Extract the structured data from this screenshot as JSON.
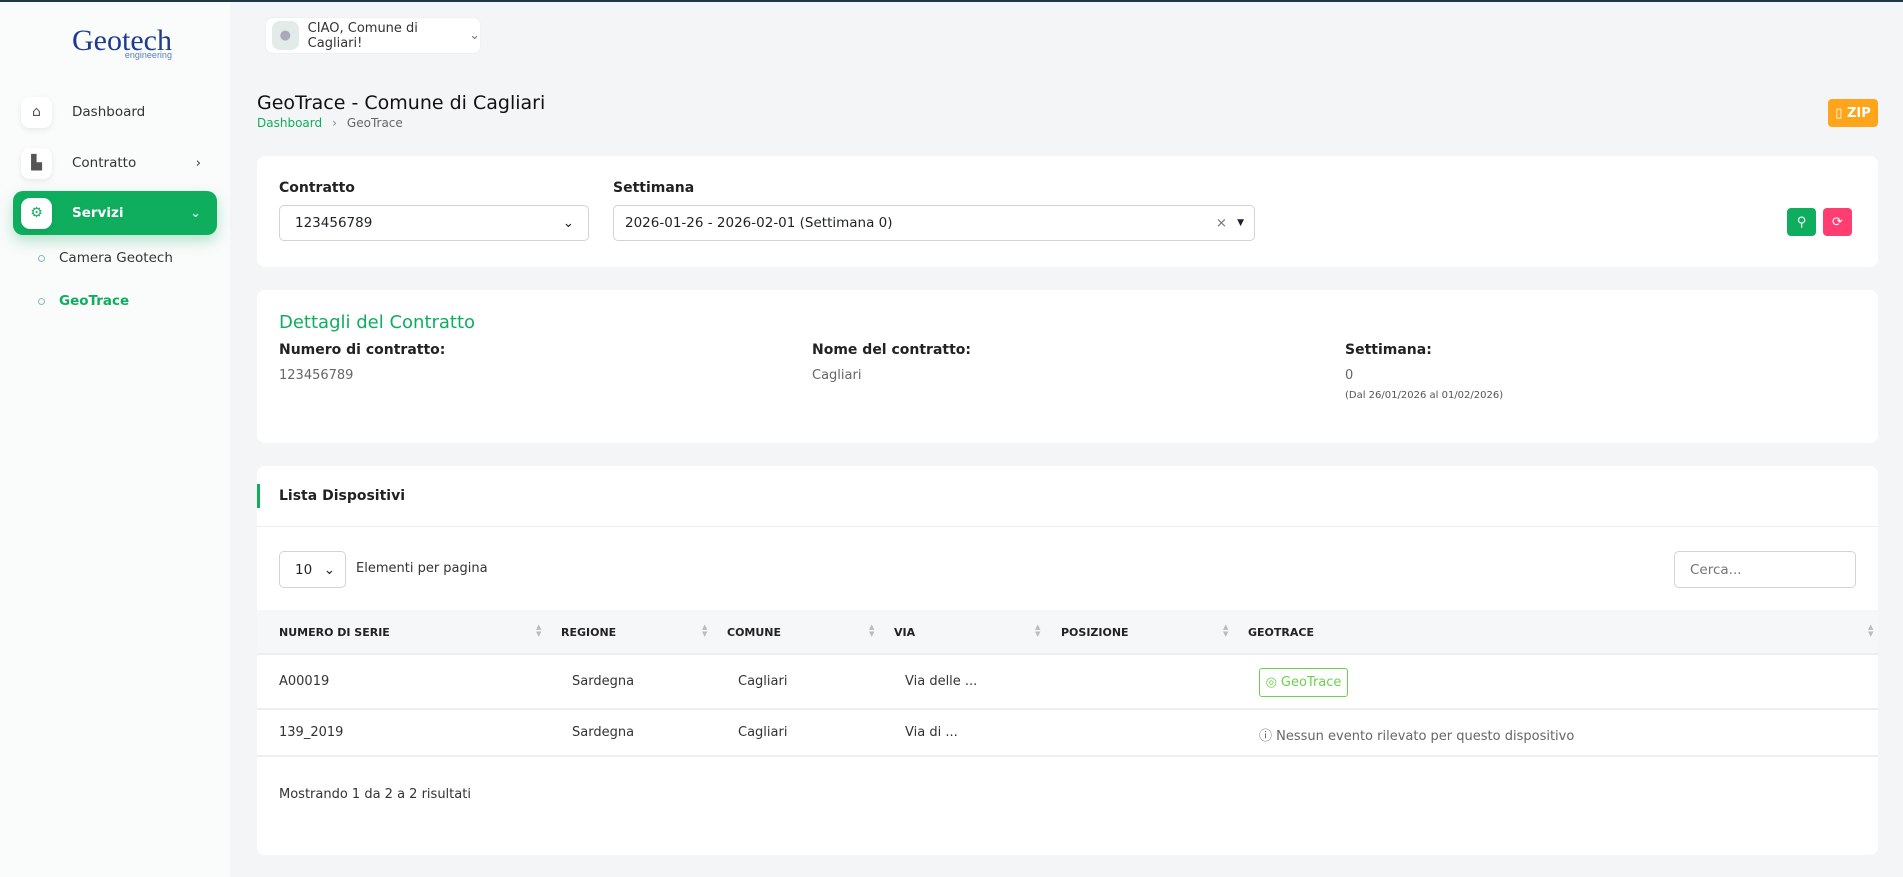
{
  "logo": {
    "text": "Geotech",
    "subtext": "engineering"
  },
  "user": {
    "greeting": "CIAO, Comune di Cagliari!"
  },
  "sidebar": {
    "items": [
      {
        "label": "Dashboard"
      },
      {
        "label": "Contratto"
      },
      {
        "label": "Servizi"
      }
    ],
    "sub": [
      {
        "label": "Camera Geotech"
      },
      {
        "label": "GeoTrace"
      }
    ]
  },
  "page": {
    "title": "GeoTrace - Comune di Cagliari",
    "breadcrumb": [
      "Dashboard",
      "GeoTrace"
    ],
    "zip_label": "ZIP"
  },
  "filters": {
    "contratto_label": "Contratto",
    "contratto_value": "123456789",
    "settimana_label": "Settimana",
    "settimana_value": "2026-01-26 - 2026-02-01 (Settimana 0)"
  },
  "details": {
    "title": "Dettagli del Contratto",
    "numero_label": "Numero di contratto:",
    "numero_value": "123456789",
    "nome_label": "Nome del contratto:",
    "nome_value": "Cagliari",
    "settimana_label": "Settimana:",
    "settimana_value": "0",
    "settimana_range": "(Dal 26/01/2026 al 01/02/2026)"
  },
  "list": {
    "title": "Lista Dispositivi",
    "per_page": "10",
    "per_page_label": "Elementi per pagina",
    "search_placeholder": "Cerca...",
    "columns": [
      "NUMERO DI SERIE",
      "REGIONE",
      "COMUNE",
      "VIA",
      "POSIZIONE",
      "GEOTRACE"
    ],
    "rows": [
      {
        "serie": "A00019",
        "regione": "Sardegna",
        "comune": "Cagliari",
        "via": "Via delle ...",
        "posizione": "",
        "geotrace": "GeoTrace"
      },
      {
        "serie": "139_2019",
        "regione": "Sardegna",
        "comune": "Cagliari",
        "via": "Via di ...",
        "posizione": "",
        "geotrace": "Nessun evento rilevato per questo dispositivo"
      }
    ],
    "footer": "Mostrando 1 da 2 a 2 risultati"
  },
  "colors": {
    "accent": "#0fae5f",
    "zip": "#ffa41b",
    "reset": "#ff3d71",
    "geotrace": "#6bd34a"
  }
}
